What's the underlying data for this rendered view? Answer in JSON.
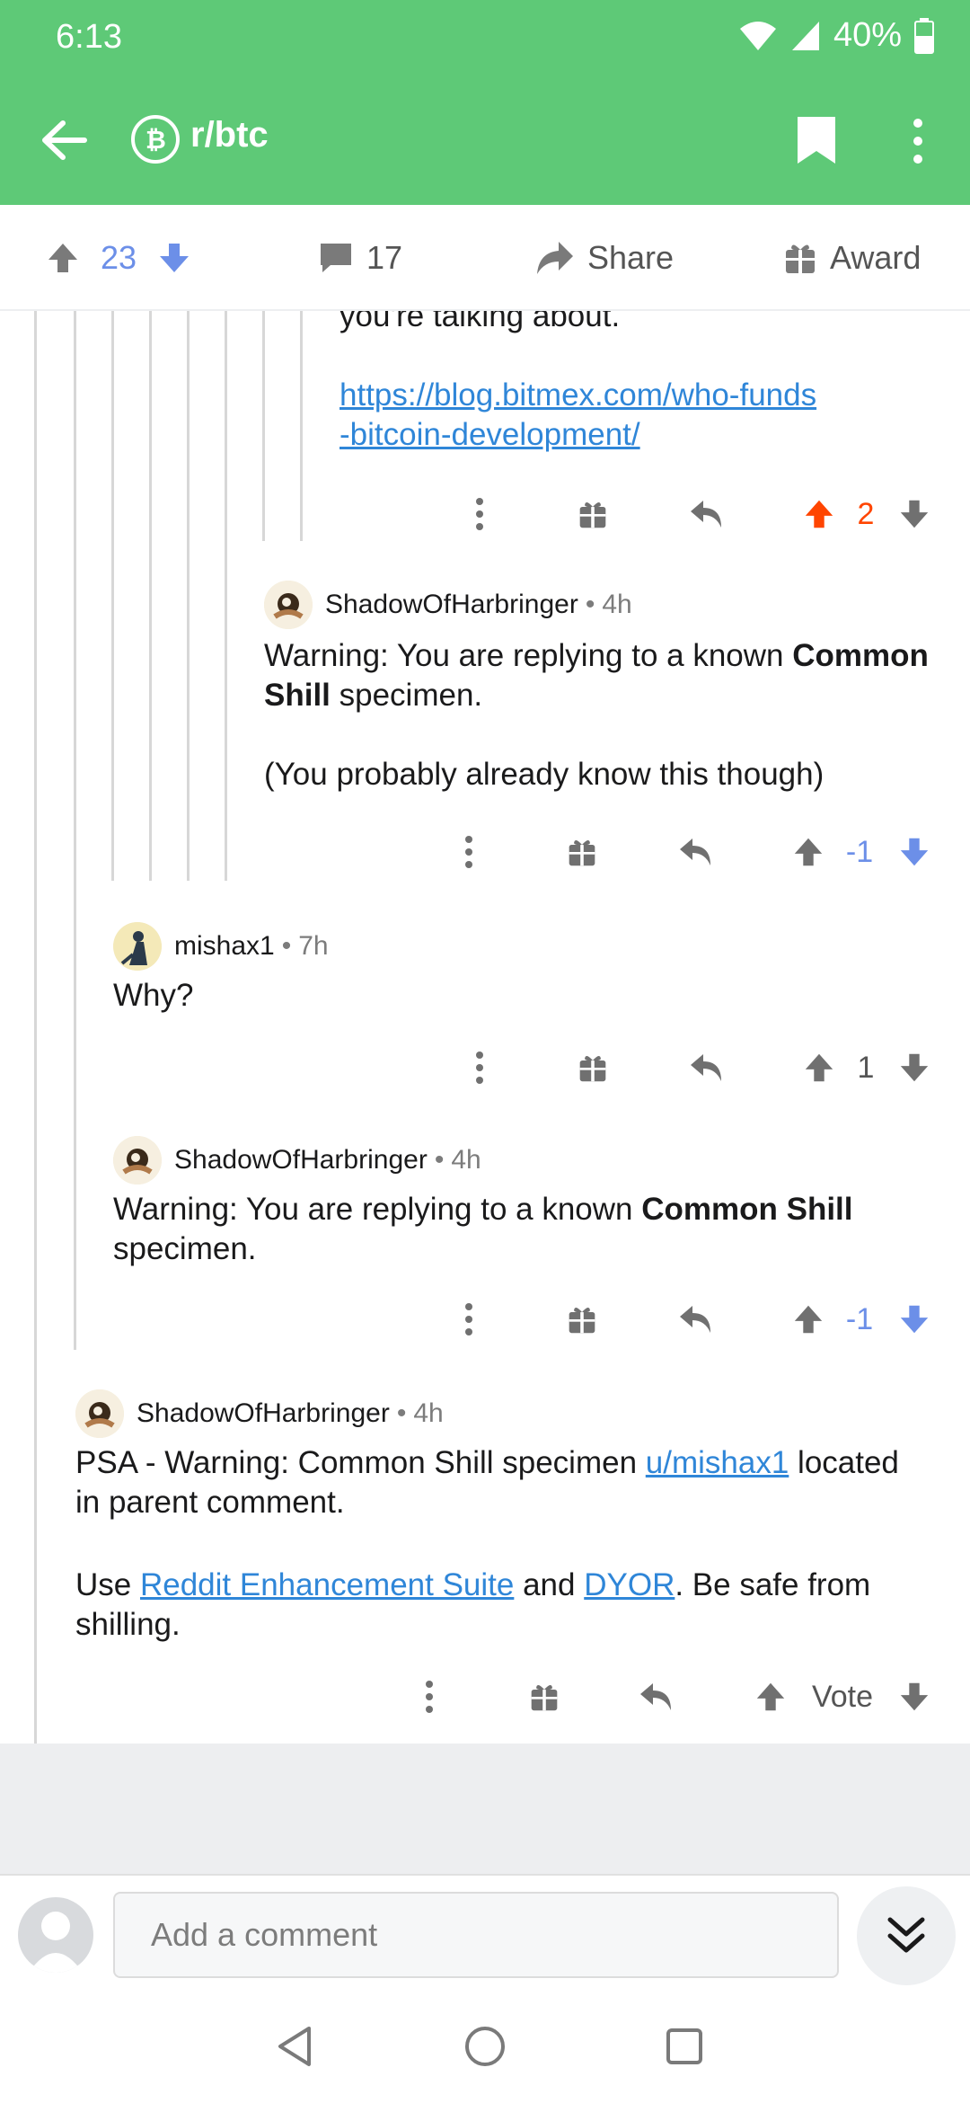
{
  "status": {
    "time": "6:13",
    "battery": "40%"
  },
  "header": {
    "subreddit": "r/btc"
  },
  "post_actions": {
    "score": "23",
    "comments": "17",
    "share_label": "Share",
    "award_label": "Award"
  },
  "comments": [
    {
      "id": "c0",
      "text_fragment": "you're talking about.",
      "link": "https://blog.bitmex.com/who-funds-bitcoin-development/",
      "link_line1": "https://blog.bitmex.com/who-funds",
      "link_line2": "-bitcoin-development/",
      "score": "2",
      "vote_state": "up"
    },
    {
      "id": "c1",
      "author": "ShadowOfHarbringer",
      "age": "4h",
      "text_prefix": "Warning: You are replying to a known ",
      "text_bold1": "Common",
      "text_bold2": "Shill",
      "text_suffix": " specimen.",
      "text_p2": "(You probably already know this though)",
      "score": "-1",
      "vote_state": "down"
    },
    {
      "id": "c2",
      "author": "mishax1",
      "age": "7h",
      "text": "Why?",
      "score": "1",
      "vote_state": "none"
    },
    {
      "id": "c3",
      "author": "ShadowOfHarbringer",
      "age": "4h",
      "text_prefix": "Warning: You are replying to a known ",
      "text_bold": "Common Shill",
      "text_suffix": "specimen.",
      "score": "-1",
      "vote_state": "down"
    },
    {
      "id": "c4",
      "author": "ShadowOfHarbringer",
      "age": "4h",
      "p1_prefix": "PSA - Warning: Common Shill specimen ",
      "p1_link": "u/mishax1",
      "p1_suffix": " located",
      "p1_line2": "in parent comment.",
      "p2_prefix": "Use ",
      "p2_link1": "Reddit Enhancement Suite",
      "p2_mid": " and ",
      "p2_link2": "DYOR",
      "p2_suffix": ". Be safe from",
      "p2_line2": "shilling.",
      "score": "Vote",
      "vote_state": "none"
    }
  ],
  "composer": {
    "placeholder": "Add a comment"
  },
  "colors": {
    "header_green": "#5ec977",
    "upvote_orange": "#ff4500",
    "downvote_blue": "#6c8fe8",
    "link_blue": "#2f86d8"
  },
  "icons": [
    "arrow-back-icon",
    "bitcoin-icon",
    "bookmark-icon",
    "more-vertical-icon",
    "upvote-icon",
    "downvote-icon",
    "comment-icon",
    "share-icon",
    "gift-icon",
    "reply-icon",
    "double-chevron-down-icon"
  ]
}
